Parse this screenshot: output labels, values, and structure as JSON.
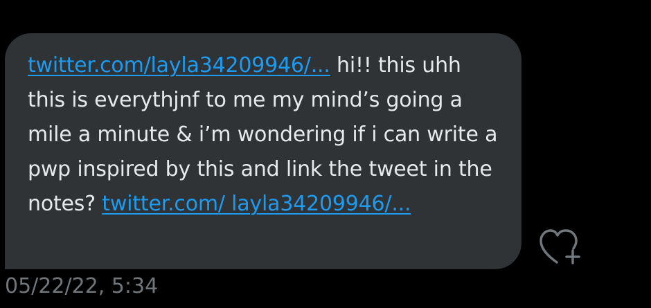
{
  "message": {
    "link_1": "twitter.com/layla34209946/...",
    "text_1": " hi!! this uhh this is everythjnf to me my mind’s going a mile a minute & i’m wondering if i can write a pwp inspired by this and link the tweet in the notes? ",
    "link_2": "twitter.com/ layla34209946/...",
    "timestamp": "05/22/22, 5:34"
  },
  "icons": {
    "reaction": "heart-plus-icon"
  },
  "colors": {
    "background": "#000000",
    "bubble": "#2f3336",
    "text": "#e7e9ea",
    "link": "#1d9bf0",
    "muted": "#71767b"
  }
}
